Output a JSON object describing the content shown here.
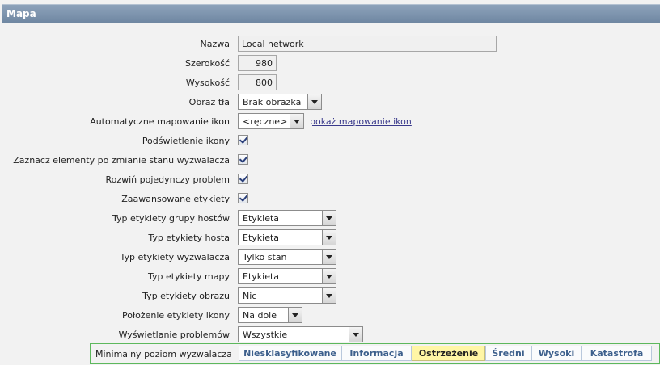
{
  "header": {
    "title": "Mapa"
  },
  "form": {
    "name": {
      "label": "Nazwa",
      "value": "Local network"
    },
    "width": {
      "label": "Szerokość",
      "value": "980"
    },
    "height": {
      "label": "Wysokość",
      "value": "800"
    },
    "background": {
      "label": "Obraz tła",
      "value": "Brak obrazka"
    },
    "icon_mapping": {
      "label": "Automatyczne mapowanie ikon",
      "value": "<ręczne>",
      "link": "pokaż mapowanie ikon"
    },
    "highlight": {
      "label": "Podświetlenie ikony",
      "checked": true
    },
    "mark_elements": {
      "label": "Zaznacz elementy po zmianie stanu wyzwalacza",
      "checked": true
    },
    "expand_problem": {
      "label": "Rozwiń pojedynczy problem",
      "checked": true
    },
    "advanced_labels": {
      "label": "Zaawansowane etykiety",
      "checked": true
    },
    "hostgroup_label": {
      "label": "Typ etykiety grupy hostów",
      "value": "Etykieta"
    },
    "host_label": {
      "label": "Typ etykiety hosta",
      "value": "Etykieta"
    },
    "trigger_label": {
      "label": "Typ etykiety wyzwalacza",
      "value": "Tylko stan"
    },
    "map_label": {
      "label": "Typ etykiety mapy",
      "value": "Etykieta"
    },
    "image_label": {
      "label": "Typ etykiety obrazu",
      "value": "Nic"
    },
    "label_location": {
      "label": "Położenie etykiety ikony",
      "value": "Na dole"
    },
    "problem_display": {
      "label": "Wyświetlanie problemów",
      "value": "Wszystkie"
    }
  },
  "severity": {
    "label": "Minimalny poziom wyzwalacza",
    "options": [
      "Niesklasyfikowane",
      "Informacja",
      "Ostrzeżenie",
      "Średni",
      "Wysoki",
      "Katastrofa"
    ],
    "selected": "Ostrzeżenie"
  }
}
